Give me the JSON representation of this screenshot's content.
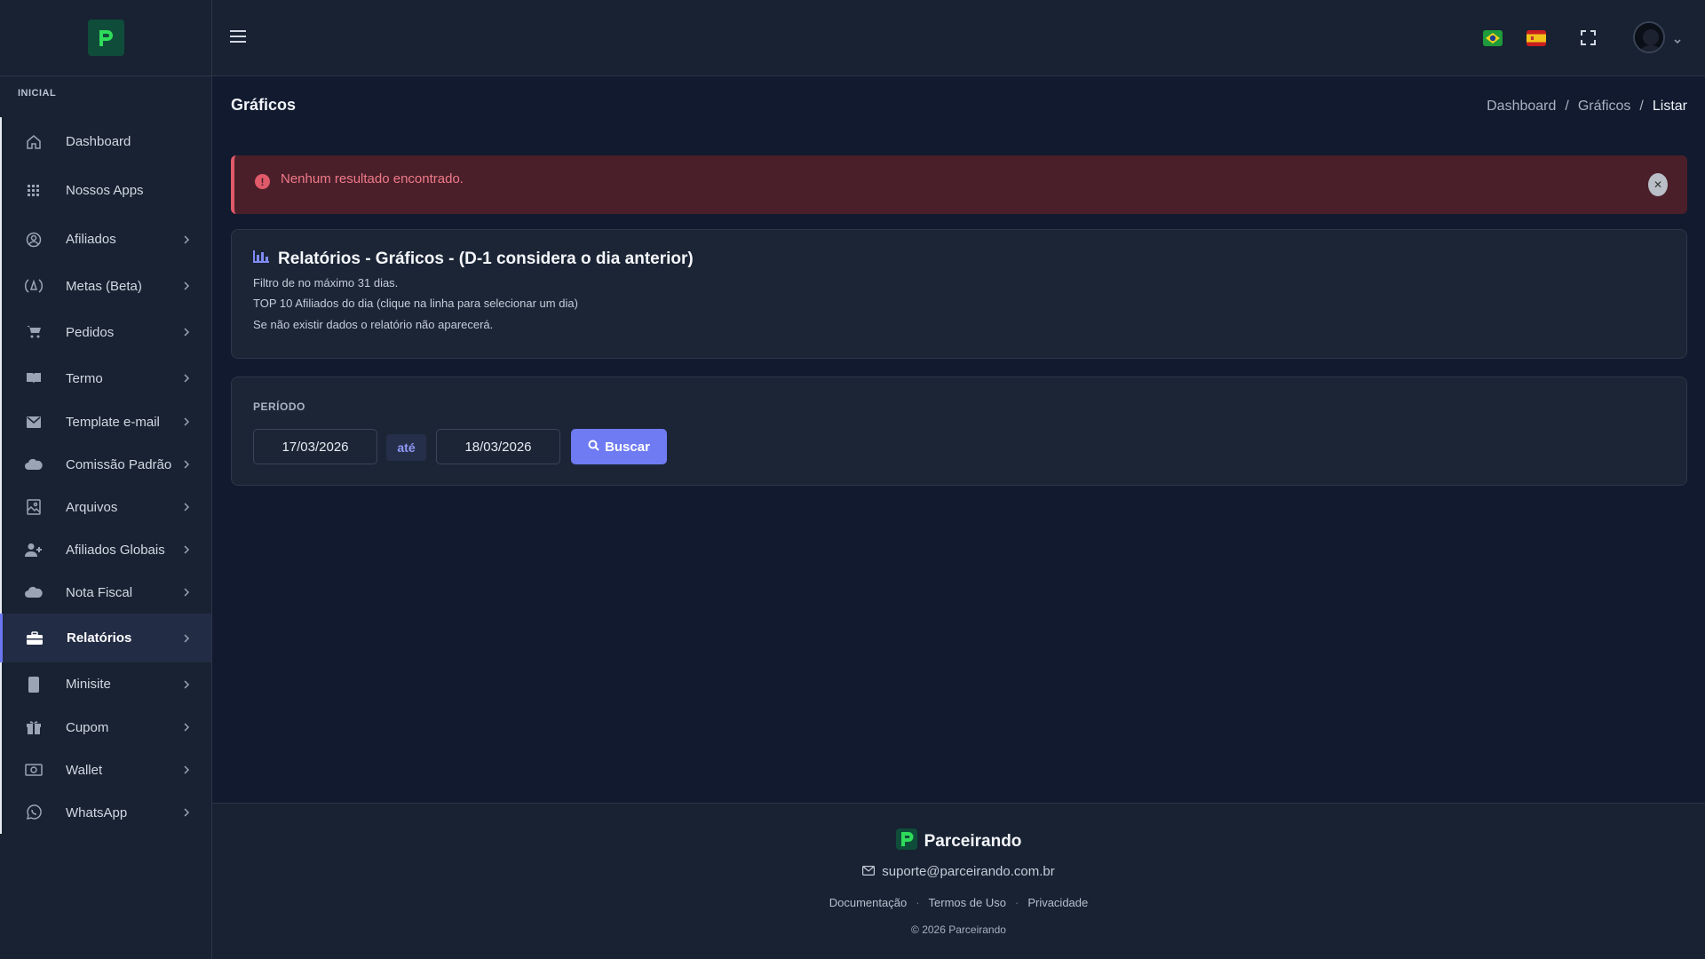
{
  "sidebar": {
    "section": "INICIAL",
    "items": [
      {
        "label": "Dashboard",
        "icon": "home-icon",
        "chev": false
      },
      {
        "label": "Nossos Apps",
        "icon": "apps-grid-icon",
        "chev": false
      },
      {
        "label": "Afiliados",
        "icon": "user-circle-icon",
        "chev": true
      },
      {
        "label": "Metas (Beta)",
        "icon": "target-icon",
        "chev": true
      },
      {
        "label": "Pedidos",
        "icon": "cart-icon",
        "chev": true
      },
      {
        "label": "Termo",
        "icon": "book-icon",
        "chev": true
      },
      {
        "label": "Template e-mail",
        "icon": "mail-icon",
        "chev": true
      },
      {
        "label": "Comissão Padrão",
        "icon": "cloud-icon",
        "chev": true
      },
      {
        "label": "Arquivos",
        "icon": "image-icon",
        "chev": true
      },
      {
        "label": "Afiliados Globais",
        "icon": "user-plus-icon",
        "chev": true
      },
      {
        "label": "Nota Fiscal",
        "icon": "cloud-icon",
        "chev": true
      },
      {
        "label": "Relatórios",
        "icon": "briefcase-icon",
        "chev": true
      },
      {
        "label": "Minisite",
        "icon": "phone-icon",
        "chev": true
      },
      {
        "label": "Cupom",
        "icon": "gift-icon",
        "chev": true
      },
      {
        "label": "Wallet",
        "icon": "money-icon",
        "chev": true
      },
      {
        "label": "WhatsApp",
        "icon": "whatsapp-icon",
        "chev": true
      }
    ],
    "active_index": 11
  },
  "header": {
    "title": "Gráficos",
    "breadcrumb": [
      "Dashboard",
      "Gráficos",
      "Listar"
    ]
  },
  "alert": {
    "text": "Nenhum resultado encontrado."
  },
  "info": {
    "title": "Relatórios - Gráficos - (D-1 considera o dia anterior)",
    "lines": [
      "Filtro de no máximo 31 dias.",
      "TOP 10 Afiliados do dia (clique na linha para selecionar um dia)",
      "Se não existir dados o relatório não aparecerá."
    ]
  },
  "filter": {
    "label": "PERÍODO",
    "start_date": "17/03/2026",
    "separator": "até",
    "end_date": "18/03/2026",
    "button": "Buscar"
  },
  "footer": {
    "brand": "Parceirando",
    "email": "suporte@parceirando.com.br",
    "links": [
      "Documentação",
      "Termos de Uso",
      "Privacidade"
    ],
    "copyright": "© 2026 Parceirando"
  },
  "colors": {
    "accent": "#6f7bf2",
    "alert_bg": "#4a1f2a",
    "alert_text": "#f07a88",
    "brand_green": "#2fdc5a"
  }
}
